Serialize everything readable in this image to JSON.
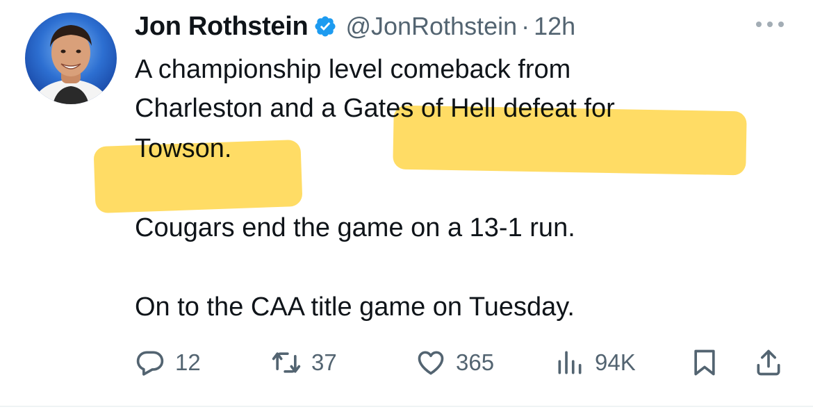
{
  "author": {
    "display_name": "Jon Rothstein",
    "handle": "@JonRothstein",
    "separator": "·",
    "time": "12h",
    "verified_icon": "verified-badge-icon",
    "verified_color": "#1d9bf0"
  },
  "tweet": {
    "lines": [
      "A championship level comeback from",
      "Charleston and a Gates of Hell defeat for",
      "Towson.",
      "Cougars end the game on a 13-1 run.",
      "On to the CAA title game on Tuesday."
    ],
    "highlight_color": "#ffd84f"
  },
  "actions": {
    "reply": {
      "icon": "reply-icon",
      "count": "12"
    },
    "retweet": {
      "icon": "retweet-icon",
      "count": "37"
    },
    "like": {
      "icon": "heart-icon",
      "count": "365"
    },
    "views": {
      "icon": "views-icon",
      "count": "94K"
    },
    "bookmark": {
      "icon": "bookmark-icon"
    },
    "share": {
      "icon": "share-icon"
    }
  },
  "colors": {
    "text": "#0f1419",
    "secondary": "#536471",
    "avatar_bg": "#2d6fd1"
  }
}
